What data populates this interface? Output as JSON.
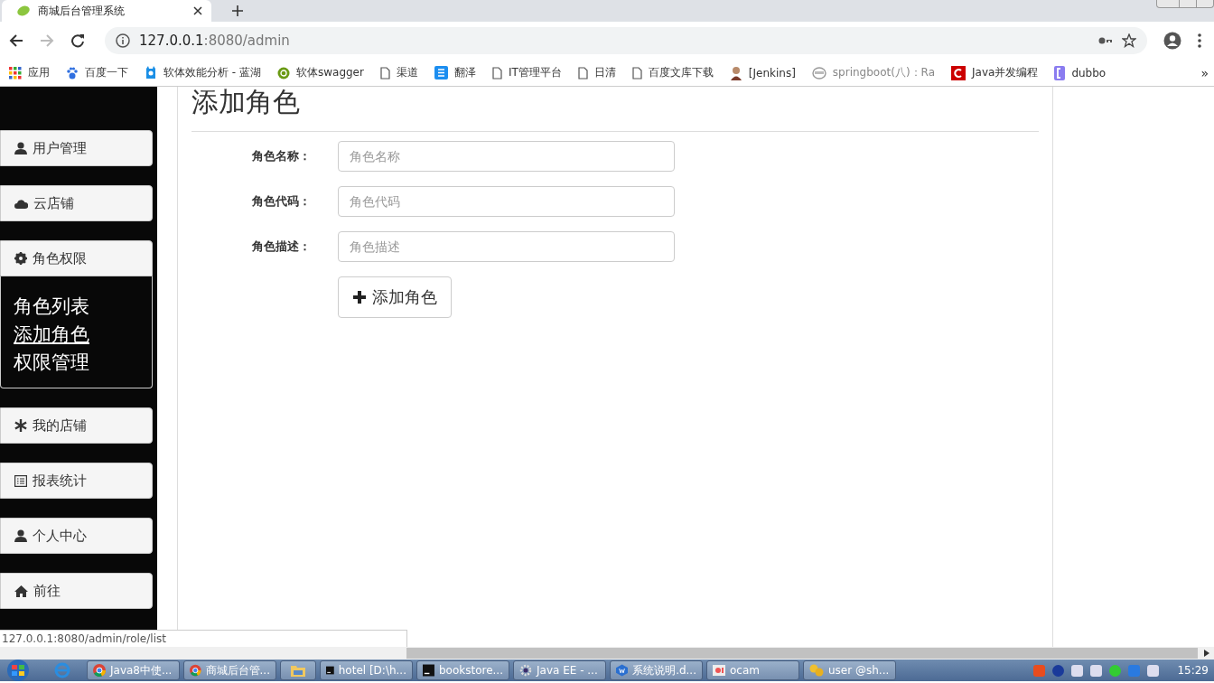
{
  "browser": {
    "tab": {
      "title": "商城后台管理系统"
    },
    "address": {
      "host": "127.0.0.1",
      "rest": ":8080/admin"
    },
    "bookmarks": [
      {
        "label": "应用"
      },
      {
        "label": "百度一下"
      },
      {
        "label": "软体效能分析 - 蓝湖"
      },
      {
        "label": "软体swagger"
      },
      {
        "label": "渠道"
      },
      {
        "label": "翻泽"
      },
      {
        "label": "IT管理平台"
      },
      {
        "label": "日清"
      },
      {
        "label": "百度文库下载"
      },
      {
        "label": "[Jenkins]"
      },
      {
        "label": "springboot(八)：Ra"
      },
      {
        "label": "Java并发编程"
      },
      {
        "label": "dubbo"
      }
    ],
    "more": "»"
  },
  "sidebar": {
    "menus": [
      {
        "label": "用户管理",
        "expanded": false
      },
      {
        "label": "云店铺",
        "expanded": false
      },
      {
        "label": "角色权限",
        "expanded": true,
        "children": [
          {
            "label": "角色列表",
            "selected": false
          },
          {
            "label": "添加角色",
            "selected": true
          },
          {
            "label": "权限管理",
            "selected": false
          }
        ]
      },
      {
        "label": "我的店铺",
        "expanded": false
      },
      {
        "label": "报表统计",
        "expanded": false
      },
      {
        "label": "个人中心",
        "expanded": false
      },
      {
        "label": "前往",
        "expanded": false
      }
    ]
  },
  "form": {
    "title": "添加角色",
    "fields": [
      {
        "label": "角色名称：",
        "placeholder": "角色名称"
      },
      {
        "label": "角色代码：",
        "placeholder": "角色代码"
      },
      {
        "label": "角色描述：",
        "placeholder": "角色描述"
      }
    ],
    "submit": "添加角色"
  },
  "status_url": "127.0.0.1:8080/admin/role/list",
  "taskbar": {
    "tasks": [
      {
        "label": "Java8中使..."
      },
      {
        "label": "商城后台管..."
      },
      {
        "label": "hotel [D:\\h..."
      },
      {
        "label": "bookstore..."
      },
      {
        "label": "Java EE - ..."
      },
      {
        "label": "系统说明.d..."
      },
      {
        "label": "ocam"
      },
      {
        "label": "user @sh..."
      }
    ],
    "clock": "15:29"
  }
}
